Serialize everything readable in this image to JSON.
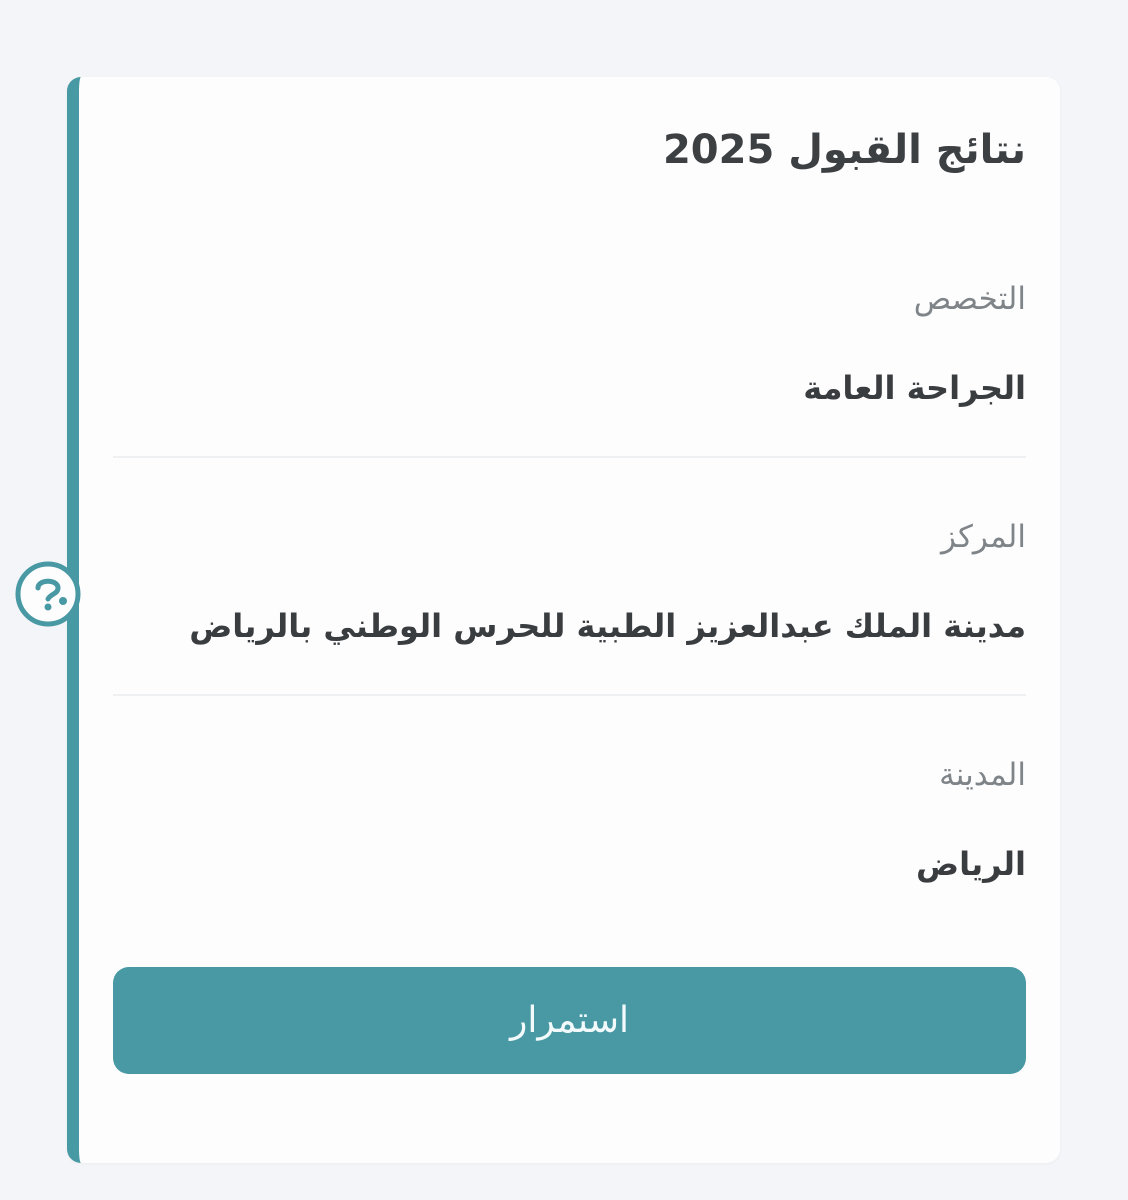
{
  "card": {
    "title": "نتائج القبول 2025"
  },
  "fields": [
    {
      "label": "التخصص",
      "value": "الجراحة العامة"
    },
    {
      "label": "المركز",
      "value": "مدينة الملك عبدالعزيز الطبية للحرس الوطني بالرياض"
    },
    {
      "label": "المدينة",
      "value": "الرياض"
    }
  ],
  "actions": {
    "continue_label": "استمرار"
  },
  "help_widget": {
    "icon": "question-chat-icon"
  },
  "colors": {
    "accent": "#4899a4",
    "background": "#f4f5f9",
    "card": "#fdfdfe",
    "title_text": "#3d4043",
    "label_text": "#7f8488",
    "value_text": "#3a3d40"
  }
}
